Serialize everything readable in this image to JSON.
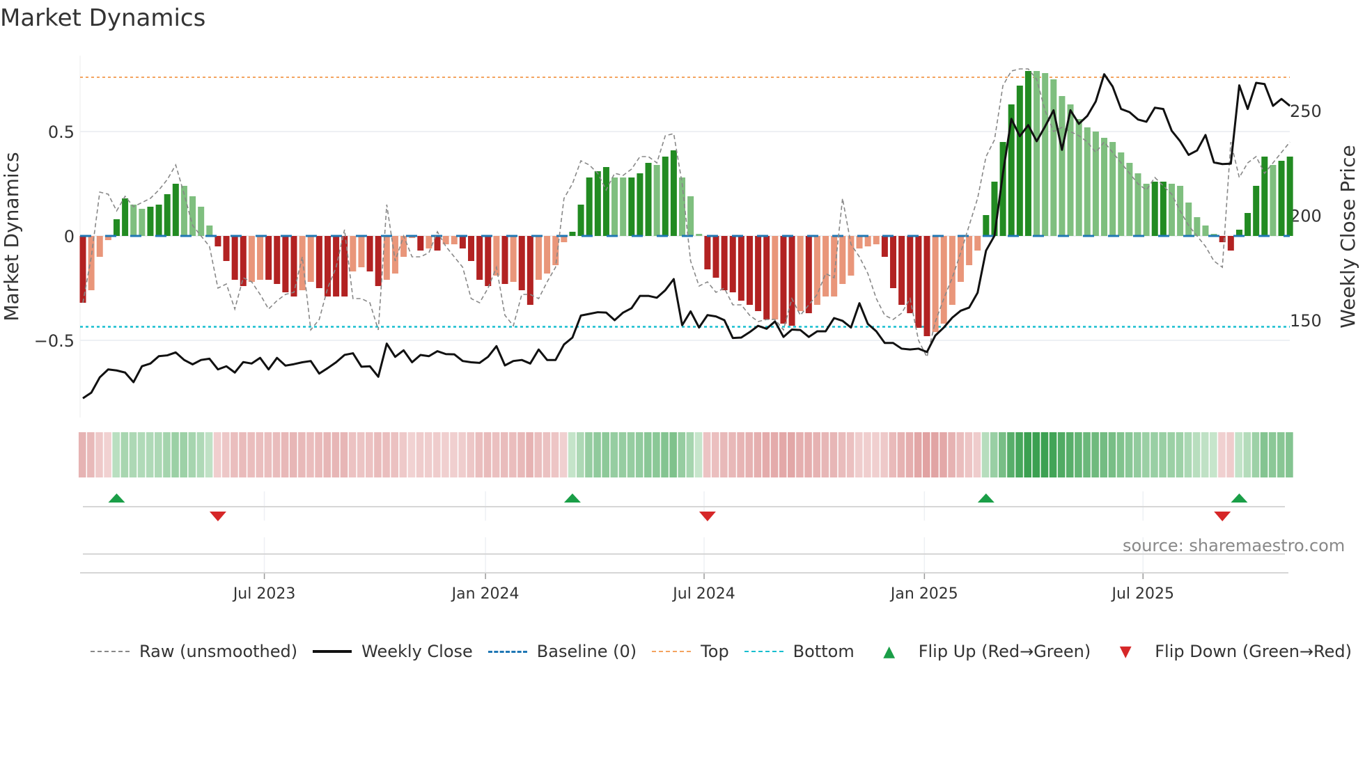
{
  "chart_data": {
    "type": "bar",
    "title": "Market Dynamics",
    "ylabel": "Market Dynamics",
    "y2label": "Weekly Close Price",
    "ylim": [
      -0.86,
      0.87
    ],
    "y2lim": [
      103,
      278
    ],
    "yticks": [
      {
        "v": 0.5,
        "label": "0.5"
      },
      {
        "v": 0,
        "label": "0"
      },
      {
        "v": -0.5,
        "label": "−0.5"
      }
    ],
    "y2ticks": [
      {
        "v": 250,
        "label": "250"
      },
      {
        "v": 200,
        "label": "200"
      },
      {
        "v": 150,
        "label": "150"
      }
    ],
    "xticks": [
      {
        "week": 21.5,
        "label": "Jul 2023"
      },
      {
        "week": 47.7,
        "label": "Jan 2024"
      },
      {
        "week": 73.6,
        "label": "Jul 2024"
      },
      {
        "week": 99.7,
        "label": "Jan 2025"
      },
      {
        "week": 125.6,
        "label": "Jul 2025"
      }
    ],
    "baseline": 0,
    "top": 0.76,
    "bottom": -0.435,
    "values": [
      -0.32,
      -0.26,
      -0.1,
      -0.02,
      0.08,
      0.18,
      0.15,
      0.13,
      0.14,
      0.15,
      0.2,
      0.25,
      0.24,
      0.19,
      0.14,
      0.05,
      -0.05,
      -0.12,
      -0.21,
      -0.24,
      -0.22,
      -0.21,
      -0.21,
      -0.23,
      -0.27,
      -0.29,
      -0.26,
      -0.22,
      -0.25,
      -0.29,
      -0.29,
      -0.29,
      -0.17,
      -0.15,
      -0.17,
      -0.24,
      -0.21,
      -0.18,
      -0.1,
      -0.01,
      -0.07,
      -0.06,
      -0.07,
      -0.04,
      -0.04,
      -0.06,
      -0.12,
      -0.21,
      -0.24,
      -0.19,
      -0.23,
      -0.22,
      -0.26,
      -0.33,
      -0.21,
      -0.18,
      -0.14,
      -0.03,
      0.02,
      0.15,
      0.28,
      0.31,
      0.33,
      0.28,
      0.28,
      0.28,
      0.3,
      0.35,
      0.34,
      0.38,
      0.41,
      0.28,
      0.19,
      0.01,
      -0.16,
      -0.2,
      -0.26,
      -0.27,
      -0.31,
      -0.33,
      -0.36,
      -0.4,
      -0.4,
      -0.42,
      -0.43,
      -0.36,
      -0.37,
      -0.33,
      -0.29,
      -0.29,
      -0.23,
      -0.19,
      -0.06,
      -0.05,
      -0.04,
      -0.1,
      -0.25,
      -0.33,
      -0.37,
      -0.44,
      -0.48,
      -0.46,
      -0.42,
      -0.33,
      -0.22,
      -0.14,
      -0.07,
      0.1,
      0.26,
      0.45,
      0.63,
      0.72,
      0.79,
      0.79,
      0.78,
      0.75,
      0.67,
      0.63,
      0.56,
      0.52,
      0.5,
      0.47,
      0.45,
      0.4,
      0.35,
      0.3,
      0.25,
      0.26,
      0.26,
      0.25,
      0.24,
      0.16,
      0.09,
      0.05,
      0.01,
      -0.03,
      -0.07,
      0.03,
      0.11,
      0.24,
      0.38,
      0.34,
      0.36,
      0.38
    ],
    "strong": [
      1,
      0,
      0,
      0,
      1,
      1,
      0,
      0,
      1,
      1,
      1,
      1,
      0,
      0,
      0,
      0,
      1,
      1,
      1,
      1,
      0,
      0,
      1,
      1,
      1,
      1,
      0,
      0,
      1,
      1,
      1,
      1,
      0,
      0,
      1,
      1,
      0,
      0,
      0,
      0,
      1,
      0,
      1,
      0,
      0,
      1,
      1,
      1,
      1,
      0,
      1,
      0,
      1,
      1,
      0,
      0,
      0,
      0,
      1,
      1,
      1,
      1,
      1,
      0,
      0,
      1,
      1,
      1,
      0,
      1,
      1,
      0,
      0,
      0,
      1,
      1,
      1,
      1,
      1,
      1,
      1,
      1,
      0,
      1,
      1,
      0,
      1,
      0,
      0,
      0,
      0,
      0,
      0,
      0,
      0,
      1,
      1,
      1,
      1,
      1,
      1,
      0,
      0,
      0,
      0,
      0,
      0,
      1,
      1,
      1,
      1,
      1,
      1,
      0,
      0,
      0,
      0,
      0,
      0,
      0,
      0,
      0,
      0,
      0,
      0,
      0,
      0,
      1,
      1,
      0,
      0,
      0,
      0,
      0,
      0,
      1,
      1,
      1,
      1,
      1,
      1,
      0,
      1,
      1
    ],
    "raw": [
      -0.32,
      -0.1,
      0.21,
      0.2,
      0.12,
      0.19,
      0.14,
      0.16,
      0.18,
      0.22,
      0.27,
      0.34,
      0.2,
      0.05,
      0.0,
      -0.05,
      -0.25,
      -0.23,
      -0.35,
      -0.2,
      -0.22,
      -0.28,
      -0.35,
      -0.31,
      -0.28,
      -0.27,
      -0.1,
      -0.45,
      -0.4,
      -0.25,
      -0.15,
      0.03,
      -0.3,
      -0.3,
      -0.32,
      -0.45,
      0.15,
      -0.12,
      0.0,
      -0.1,
      -0.1,
      -0.08,
      0.02,
      -0.05,
      -0.1,
      -0.15,
      -0.3,
      -0.32,
      -0.25,
      -0.15,
      -0.38,
      -0.43,
      -0.28,
      -0.28,
      -0.3,
      -0.22,
      -0.15,
      0.18,
      0.25,
      0.36,
      0.34,
      0.3,
      0.22,
      0.3,
      0.29,
      0.32,
      0.38,
      0.38,
      0.35,
      0.48,
      0.49,
      0.25,
      -0.12,
      -0.24,
      -0.22,
      -0.27,
      -0.25,
      -0.33,
      -0.33,
      -0.38,
      -0.41,
      -0.4,
      -0.4,
      -0.45,
      -0.3,
      -0.38,
      -0.33,
      -0.28,
      -0.18,
      -0.2,
      0.18,
      -0.04,
      -0.1,
      -0.18,
      -0.3,
      -0.38,
      -0.4,
      -0.37,
      -0.3,
      -0.5,
      -0.58,
      -0.41,
      -0.3,
      -0.2,
      -0.08,
      0.05,
      0.18,
      0.38,
      0.46,
      0.72,
      0.79,
      0.8,
      0.8,
      0.75,
      0.6,
      0.5,
      0.52,
      0.5,
      0.48,
      0.45,
      0.4,
      0.45,
      0.4,
      0.35,
      0.3,
      0.25,
      0.22,
      0.28,
      0.24,
      0.2,
      0.12,
      0.05,
      0.0,
      -0.05,
      -0.12,
      -0.15,
      0.45,
      0.28,
      0.35,
      0.38,
      0.3,
      0.35,
      0.4,
      0.45
    ],
    "close": [
      112.7,
      115.4,
      122.7,
      126.5,
      126,
      125,
      120.4,
      128,
      129.3,
      132.8,
      133.2,
      134.6,
      131,
      128.9,
      131,
      131.6,
      126.5,
      128,
      125,
      130,
      129.3,
      132,
      126.5,
      132,
      128.3,
      129,
      129.9,
      130.5,
      124.5,
      127.1,
      129.9,
      133.4,
      134.2,
      127.8,
      128,
      123,
      138.8,
      132.5,
      135.6,
      129.9,
      133.4,
      132.8,
      135.2,
      133.8,
      133.7,
      130.5,
      129.9,
      129.6,
      132.5,
      137.6,
      128.4,
      130.5,
      131,
      129.3,
      136,
      131,
      131,
      138.4,
      141.7,
      152.2,
      153,
      153.8,
      153.6,
      150,
      153.6,
      155.7,
      161.6,
      161.6,
      160.7,
      164.3,
      169.6,
      147.6,
      154.2,
      146.5,
      152.4,
      151.8,
      150,
      141.5,
      141.7,
      144.3,
      147.3,
      145.9,
      149.4,
      142,
      145.5,
      145.3,
      142,
      144.7,
      144.7,
      151,
      149.7,
      146.5,
      158.1,
      148.2,
      144.7,
      139.1,
      139.1,
      136.4,
      136,
      136.4,
      134.8,
      142.7,
      146.5,
      151.2,
      154.5,
      156,
      163.1,
      183.2,
      190.3,
      220,
      246.1,
      237.8,
      243.1,
      235.4,
      242.5,
      250.2,
      231.3,
      250.2,
      243.7,
      247.5,
      254.4,
      267.4,
      261.5,
      250.8,
      249.3,
      245.8,
      244.7,
      251.4,
      250.8,
      240.4,
      235.4,
      228.9,
      231,
      238.4,
      225.3,
      224.5,
      224.7,
      262.1,
      250.8,
      263.3,
      262.7,
      252.3,
      255.6,
      252.3
    ],
    "flip_up_weeks": [
      4,
      58,
      107,
      137
    ],
    "flip_down_weeks": [
      16,
      74,
      135
    ],
    "legend": [
      {
        "key": "raw",
        "label": "Raw (unsmoothed)"
      },
      {
        "key": "close",
        "label": "Weekly Close"
      },
      {
        "key": "baseline",
        "label": "Baseline (0)"
      },
      {
        "key": "top",
        "label": "Top"
      },
      {
        "key": "bottom",
        "label": "Bottom"
      },
      {
        "key": "flip_up",
        "label": "Flip Up (Red→Green)"
      },
      {
        "key": "flip_down",
        "label": "Flip Down (Green→Red)"
      }
    ],
    "legend_position": "bottom",
    "colors": {
      "strong_up": "#228b22",
      "weak_up": "#7fbf7f",
      "strong_down": "#b22222",
      "weak_down": "#e9967a",
      "close": "#111111",
      "raw": "#888888",
      "baseline": "#1f77b4",
      "top": "#f4a460",
      "bottom": "#17becf",
      "flip_up": "#1a9e47",
      "flip_down": "#d62728"
    },
    "source": "source: sharemaestro.com"
  }
}
